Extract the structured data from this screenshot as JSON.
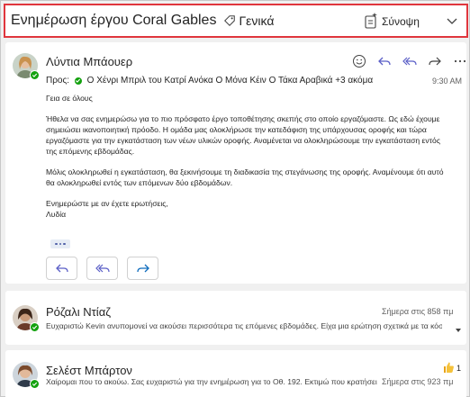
{
  "header": {
    "subject": "Ενημέρωση έργου Coral Gables",
    "tag_label": "Γενικά",
    "summary_label": "Σύνοψη"
  },
  "message": {
    "sender": "Λύντια Μπάουερ",
    "to_prefix": "Προς:",
    "recipients": "Ο Χένρι Μπριλ του Κατρί Ανόκα Ο Μόνα Κέιν Ο Τάκα Αραβικά +3 ακόμα",
    "time": "9:30 AM",
    "body": {
      "greeting": "Γεια σε όλους",
      "p1": "Ήθελα να σας ενημερώσω για το πιο πρόσφατο έργο τοποθέτησης σκεπής στο οποίο εργαζόμαστε. Ως εδώ έχουμε σημειώσει ικανοποιητική πρόοδο. Η ομάδα μας ολοκλήρωσε την κατεδάφιση της υπάρχουσας οροφής και τώρα εργαζόμαστε για την εγκατάσταση των νέων υλικών οροφής. Αναμένεται να ολοκληρώσουμε την εγκατάσταση εντός της επόμενης εβδομάδας.",
      "p2": "Μόλις ολοκληρωθεί η εγκατάσταση, θα ξεκινήσουμε τη διαδικασία της στεγάνωσης της οροφής. Αναμένουμε ότι αυτό θα ολοκληρωθεί εντός των επόμενων δύο εβδομάδων.",
      "closing": "Ενημερώστε με αν έχετε ερωτήσεις,",
      "signature": "Λυδία"
    }
  },
  "message2": {
    "sender": "Ρόζαλι Ντίαζ",
    "time": "Σήμερα στις 858 πμ",
    "preview": "Ευχαριστώ Kevin ανυπομονεί να ακούσει περισσότερα τις επόμενες εβδομάδες. Είχα μια ερώτηση σχετικά με τα κόστη της ..."
  },
  "message3": {
    "sender": "Σελέστ Μπάρτον",
    "time": "Σήμερα στις 923 πμ",
    "preview": "Χαίρομαι που το ακούω. Σας ευχαριστώ για την ενημέρωση για το Οθ. 192. Εκτιμώ που κρατήσει ζωντανά...",
    "reaction_count": "1"
  },
  "colors": {
    "accent": "#5b5fc7",
    "highlight_border": "#e0363d",
    "presence": "#13a10e"
  }
}
